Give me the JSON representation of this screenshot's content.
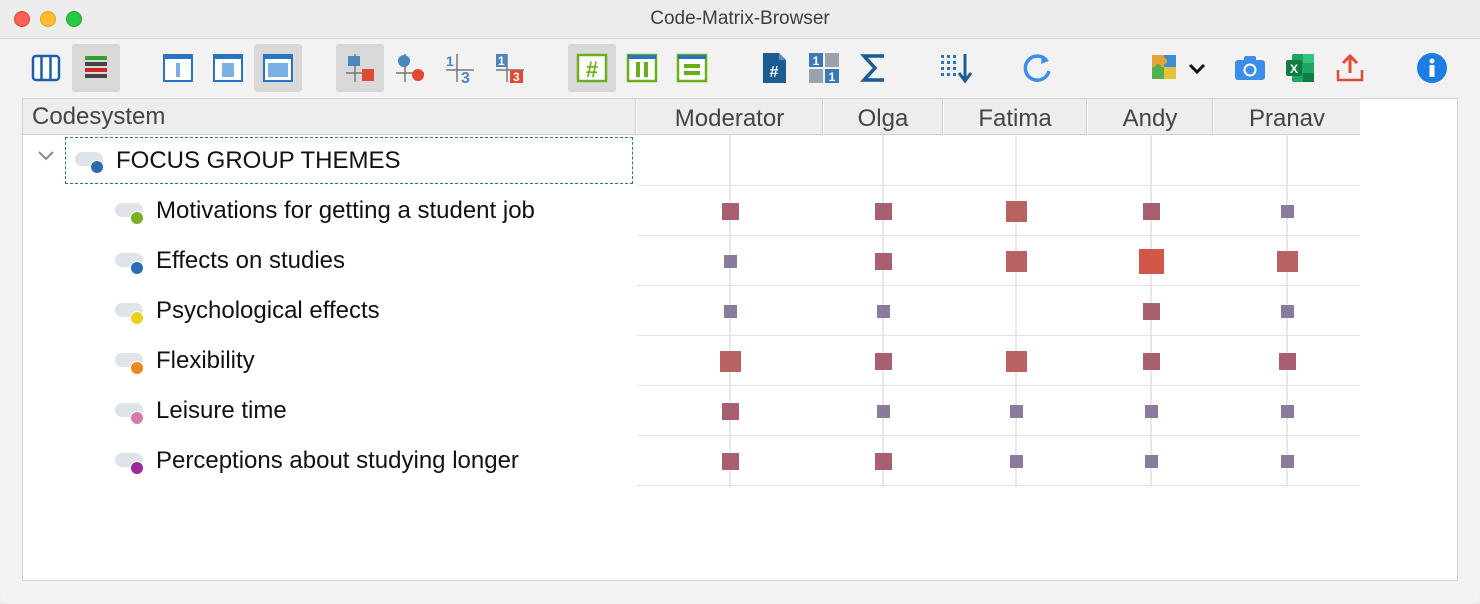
{
  "window": {
    "title": "Code-Matrix-Browser"
  },
  "toolbar": {
    "buttons": [
      {
        "name": "columns-view-icon"
      },
      {
        "name": "colored-rows-icon"
      },
      {
        "name": "narrow-column-icon"
      },
      {
        "name": "medium-column-icon"
      },
      {
        "name": "wide-column-icon"
      },
      {
        "name": "squares-symbol-icon"
      },
      {
        "name": "circles-symbol-icon"
      },
      {
        "name": "numbers-symbol-icon"
      },
      {
        "name": "heatmap-numbers-icon"
      },
      {
        "name": "hash-grid-icon"
      },
      {
        "name": "column-totals-icon"
      },
      {
        "name": "row-totals-icon"
      },
      {
        "name": "document-hash-icon"
      },
      {
        "name": "binary-grid-icon"
      },
      {
        "name": "sigma-icon"
      },
      {
        "name": "sort-down-icon"
      },
      {
        "name": "refresh-icon"
      },
      {
        "name": "puzzle-export-icon"
      },
      {
        "name": "camera-icon"
      },
      {
        "name": "excel-icon"
      },
      {
        "name": "export-icon"
      },
      {
        "name": "info-icon"
      }
    ]
  },
  "header": {
    "codesystem": "Codesystem",
    "columns": [
      "Moderator",
      "Olga",
      "Fatima",
      "Andy",
      "Pranav"
    ]
  },
  "tree": {
    "root": {
      "label": "FOCUS GROUP THEMES",
      "color": "#2a6cb0"
    },
    "codes": [
      {
        "label": "Motivations for getting a student job",
        "color": "#7bb01f",
        "cells": [
          2,
          2,
          3,
          2,
          1
        ]
      },
      {
        "label": "Effects on studies",
        "color": "#2a6cb0",
        "cells": [
          1,
          2,
          3,
          4,
          3
        ]
      },
      {
        "label": "Psychological effects",
        "color": "#e8d21c",
        "cells": [
          1,
          1,
          0,
          2,
          1
        ]
      },
      {
        "label": "Flexibility",
        "color": "#ea8a1e",
        "cells": [
          3,
          2,
          3,
          2,
          2
        ]
      },
      {
        "label": "Leisure time",
        "color": "#d67ab0",
        "cells": [
          2,
          1,
          1,
          1,
          1
        ]
      },
      {
        "label": "Perceptions about studying longer",
        "color": "#9b2aa0",
        "cells": [
          2,
          2,
          1,
          1,
          1
        ]
      }
    ]
  },
  "colors": {
    "level1": "#8a7a9c",
    "level2": "#a86070",
    "level3": "#b96262",
    "level4": "#d15848"
  }
}
